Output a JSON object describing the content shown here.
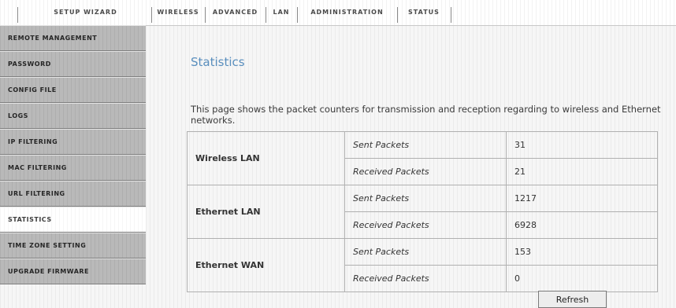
{
  "topnav": {
    "items": [
      {
        "label": "Setup Wizard"
      },
      {
        "label": "Wireless"
      },
      {
        "label": "Advanced"
      },
      {
        "label": "LAN"
      },
      {
        "label": "Administration"
      },
      {
        "label": "Status"
      }
    ]
  },
  "sidebar": {
    "items": [
      {
        "label": "Remote Management"
      },
      {
        "label": "Password"
      },
      {
        "label": "Config File"
      },
      {
        "label": "Logs"
      },
      {
        "label": "IP Filtering"
      },
      {
        "label": "MAC Filtering"
      },
      {
        "label": "URL Filtering"
      },
      {
        "label": "Statistics",
        "active": true
      },
      {
        "label": "Time Zone Setting"
      },
      {
        "label": "Upgrade Firmware"
      }
    ]
  },
  "main": {
    "title": "Statistics",
    "intro": "This page shows the packet counters for transmission and reception regarding to wireless and Ethernet networks.",
    "stats": [
      {
        "group": "Wireless LAN",
        "rows": [
          {
            "label": "Sent Packets",
            "value": "31"
          },
          {
            "label": "Received Packets",
            "value": "21"
          }
        ]
      },
      {
        "group": "Ethernet LAN",
        "rows": [
          {
            "label": "Sent Packets",
            "value": "1217"
          },
          {
            "label": "Received Packets",
            "value": "6928"
          }
        ]
      },
      {
        "group": "Ethernet WAN",
        "rows": [
          {
            "label": "Sent Packets",
            "value": "153"
          },
          {
            "label": "Received Packets",
            "value": "0"
          }
        ]
      }
    ],
    "refresh_label": "Refresh"
  },
  "colors": {
    "title": "#5a8fbe",
    "sidebar_bg": "#b9b9b9",
    "sidebar_active_bg": "#ffffff"
  }
}
